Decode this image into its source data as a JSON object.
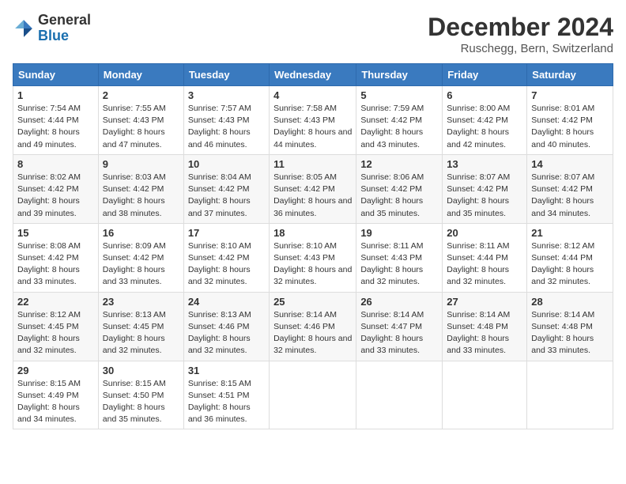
{
  "logo": {
    "general": "General",
    "blue": "Blue"
  },
  "header": {
    "month": "December 2024",
    "location": "Ruschegg, Bern, Switzerland"
  },
  "weekdays": [
    "Sunday",
    "Monday",
    "Tuesday",
    "Wednesday",
    "Thursday",
    "Friday",
    "Saturday"
  ],
  "weeks": [
    [
      {
        "day": "1",
        "sunrise": "7:54 AM",
        "sunset": "4:44 PM",
        "daylight": "8 hours and 49 minutes."
      },
      {
        "day": "2",
        "sunrise": "7:55 AM",
        "sunset": "4:43 PM",
        "daylight": "8 hours and 47 minutes."
      },
      {
        "day": "3",
        "sunrise": "7:57 AM",
        "sunset": "4:43 PM",
        "daylight": "8 hours and 46 minutes."
      },
      {
        "day": "4",
        "sunrise": "7:58 AM",
        "sunset": "4:43 PM",
        "daylight": "8 hours and 44 minutes."
      },
      {
        "day": "5",
        "sunrise": "7:59 AM",
        "sunset": "4:42 PM",
        "daylight": "8 hours and 43 minutes."
      },
      {
        "day": "6",
        "sunrise": "8:00 AM",
        "sunset": "4:42 PM",
        "daylight": "8 hours and 42 minutes."
      },
      {
        "day": "7",
        "sunrise": "8:01 AM",
        "sunset": "4:42 PM",
        "daylight": "8 hours and 40 minutes."
      }
    ],
    [
      {
        "day": "8",
        "sunrise": "8:02 AM",
        "sunset": "4:42 PM",
        "daylight": "8 hours and 39 minutes."
      },
      {
        "day": "9",
        "sunrise": "8:03 AM",
        "sunset": "4:42 PM",
        "daylight": "8 hours and 38 minutes."
      },
      {
        "day": "10",
        "sunrise": "8:04 AM",
        "sunset": "4:42 PM",
        "daylight": "8 hours and 37 minutes."
      },
      {
        "day": "11",
        "sunrise": "8:05 AM",
        "sunset": "4:42 PM",
        "daylight": "8 hours and 36 minutes."
      },
      {
        "day": "12",
        "sunrise": "8:06 AM",
        "sunset": "4:42 PM",
        "daylight": "8 hours and 35 minutes."
      },
      {
        "day": "13",
        "sunrise": "8:07 AM",
        "sunset": "4:42 PM",
        "daylight": "8 hours and 35 minutes."
      },
      {
        "day": "14",
        "sunrise": "8:07 AM",
        "sunset": "4:42 PM",
        "daylight": "8 hours and 34 minutes."
      }
    ],
    [
      {
        "day": "15",
        "sunrise": "8:08 AM",
        "sunset": "4:42 PM",
        "daylight": "8 hours and 33 minutes."
      },
      {
        "day": "16",
        "sunrise": "8:09 AM",
        "sunset": "4:42 PM",
        "daylight": "8 hours and 33 minutes."
      },
      {
        "day": "17",
        "sunrise": "8:10 AM",
        "sunset": "4:42 PM",
        "daylight": "8 hours and 32 minutes."
      },
      {
        "day": "18",
        "sunrise": "8:10 AM",
        "sunset": "4:43 PM",
        "daylight": "8 hours and 32 minutes."
      },
      {
        "day": "19",
        "sunrise": "8:11 AM",
        "sunset": "4:43 PM",
        "daylight": "8 hours and 32 minutes."
      },
      {
        "day": "20",
        "sunrise": "8:11 AM",
        "sunset": "4:44 PM",
        "daylight": "8 hours and 32 minutes."
      },
      {
        "day": "21",
        "sunrise": "8:12 AM",
        "sunset": "4:44 PM",
        "daylight": "8 hours and 32 minutes."
      }
    ],
    [
      {
        "day": "22",
        "sunrise": "8:12 AM",
        "sunset": "4:45 PM",
        "daylight": "8 hours and 32 minutes."
      },
      {
        "day": "23",
        "sunrise": "8:13 AM",
        "sunset": "4:45 PM",
        "daylight": "8 hours and 32 minutes."
      },
      {
        "day": "24",
        "sunrise": "8:13 AM",
        "sunset": "4:46 PM",
        "daylight": "8 hours and 32 minutes."
      },
      {
        "day": "25",
        "sunrise": "8:14 AM",
        "sunset": "4:46 PM",
        "daylight": "8 hours and 32 minutes."
      },
      {
        "day": "26",
        "sunrise": "8:14 AM",
        "sunset": "4:47 PM",
        "daylight": "8 hours and 33 minutes."
      },
      {
        "day": "27",
        "sunrise": "8:14 AM",
        "sunset": "4:48 PM",
        "daylight": "8 hours and 33 minutes."
      },
      {
        "day": "28",
        "sunrise": "8:14 AM",
        "sunset": "4:48 PM",
        "daylight": "8 hours and 33 minutes."
      }
    ],
    [
      {
        "day": "29",
        "sunrise": "8:15 AM",
        "sunset": "4:49 PM",
        "daylight": "8 hours and 34 minutes."
      },
      {
        "day": "30",
        "sunrise": "8:15 AM",
        "sunset": "4:50 PM",
        "daylight": "8 hours and 35 minutes."
      },
      {
        "day": "31",
        "sunrise": "8:15 AM",
        "sunset": "4:51 PM",
        "daylight": "8 hours and 36 minutes."
      },
      null,
      null,
      null,
      null
    ]
  ]
}
